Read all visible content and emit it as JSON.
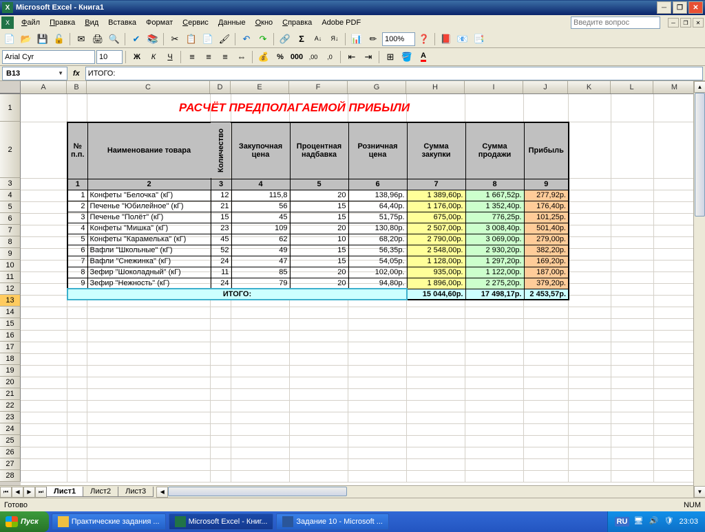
{
  "titlebar": {
    "title": "Microsoft Excel - Книга1"
  },
  "menus": [
    "Файл",
    "Правка",
    "Вид",
    "Вставка",
    "Формат",
    "Сервис",
    "Данные",
    "Окно",
    "Справка",
    "Adobe PDF"
  ],
  "ask_placeholder": "Введите вопрос",
  "font_name": "Arial Cyr",
  "font_size": "10",
  "zoom": "100%",
  "namebox": "B13",
  "formula": "ИТОГО:",
  "columns": [
    {
      "l": "A",
      "w": 67
    },
    {
      "l": "B",
      "w": 29
    },
    {
      "l": "C",
      "w": 179
    },
    {
      "l": "D",
      "w": 30
    },
    {
      "l": "E",
      "w": 85
    },
    {
      "l": "F",
      "w": 85
    },
    {
      "l": "G",
      "w": 85
    },
    {
      "l": "H",
      "w": 85
    },
    {
      "l": "I",
      "w": 85
    },
    {
      "l": "J",
      "w": 65
    },
    {
      "l": "K",
      "w": 62
    },
    {
      "l": "L",
      "w": 62
    },
    {
      "l": "M",
      "w": 62
    }
  ],
  "rows": [
    {
      "n": 1,
      "h": 40
    },
    {
      "n": 2,
      "h": 82
    },
    {
      "n": 3,
      "h": 17
    },
    {
      "n": 4,
      "h": 17
    },
    {
      "n": 5,
      "h": 17
    },
    {
      "n": 6,
      "h": 17
    },
    {
      "n": 7,
      "h": 17
    },
    {
      "n": 8,
      "h": 17
    },
    {
      "n": 9,
      "h": 17
    },
    {
      "n": 10,
      "h": 17
    },
    {
      "n": 11,
      "h": 17
    },
    {
      "n": 12,
      "h": 17
    },
    {
      "n": 13,
      "h": 17
    },
    {
      "n": 14,
      "h": 17
    },
    {
      "n": 15,
      "h": 17
    },
    {
      "n": 16,
      "h": 17
    },
    {
      "n": 17,
      "h": 17
    },
    {
      "n": 18,
      "h": 17
    },
    {
      "n": 19,
      "h": 17
    },
    {
      "n": 20,
      "h": 17
    },
    {
      "n": 21,
      "h": 17
    },
    {
      "n": 22,
      "h": 17
    },
    {
      "n": 23,
      "h": 17
    },
    {
      "n": 24,
      "h": 17
    },
    {
      "n": 25,
      "h": 17
    },
    {
      "n": 26,
      "h": 17
    },
    {
      "n": 27,
      "h": 17
    },
    {
      "n": 28,
      "h": 17
    }
  ],
  "sheet_title": "РАСЧЁТ ПРЕДПОЛАГАЕМОЙ ПРИБЫЛИ",
  "headers": {
    "c1": "№ п.п.",
    "c2": "Наименование товара",
    "c3": "Количество",
    "c4": "Закупочная цена",
    "c5": "Процентная надбавка",
    "c6": "Розничная цена",
    "c7": "Сумма закупки",
    "c8": "Сумма продажи",
    "c9": "Прибыль"
  },
  "numrow": [
    "1",
    "2",
    "3",
    "4",
    "5",
    "6",
    "7",
    "8",
    "9"
  ],
  "data": [
    {
      "n": "1",
      "name": "Конфеты \"Белочка\" (кГ)",
      "qty": "12",
      "buy": "115,8",
      "pct": "20",
      "retail": "138,96р.",
      "sumbuy": "1 389,60р.",
      "sumsell": "1 667,52р.",
      "profit": "277,92р."
    },
    {
      "n": "2",
      "name": "Печенье \"Юбилейное\" (кГ)",
      "qty": "21",
      "buy": "56",
      "pct": "15",
      "retail": "64,40р.",
      "sumbuy": "1 176,00р.",
      "sumsell": "1 352,40р.",
      "profit": "176,40р."
    },
    {
      "n": "3",
      "name": "Печенье \"Полёт\" (кГ)",
      "qty": "15",
      "buy": "45",
      "pct": "15",
      "retail": "51,75р.",
      "sumbuy": "675,00р.",
      "sumsell": "776,25р.",
      "profit": "101,25р."
    },
    {
      "n": "4",
      "name": "Конфеты \"Мишка\" (кГ)",
      "qty": "23",
      "buy": "109",
      "pct": "20",
      "retail": "130,80р.",
      "sumbuy": "2 507,00р.",
      "sumsell": "3 008,40р.",
      "profit": "501,40р."
    },
    {
      "n": "5",
      "name": "Конфеты \"Карамелька\" (кГ)",
      "qty": "45",
      "buy": "62",
      "pct": "10",
      "retail": "68,20р.",
      "sumbuy": "2 790,00р.",
      "sumsell": "3 069,00р.",
      "profit": "279,00р."
    },
    {
      "n": "6",
      "name": "Вафли \"Школьные\" (кГ)",
      "qty": "52",
      "buy": "49",
      "pct": "15",
      "retail": "56,35р.",
      "sumbuy": "2 548,00р.",
      "sumsell": "2 930,20р.",
      "profit": "382,20р."
    },
    {
      "n": "7",
      "name": "Вафли \"Снежинка\" (кГ)",
      "qty": "24",
      "buy": "47",
      "pct": "15",
      "retail": "54,05р.",
      "sumbuy": "1 128,00р.",
      "sumsell": "1 297,20р.",
      "profit": "169,20р."
    },
    {
      "n": "8",
      "name": "Зефир \"Шоколадный\" (кГ)",
      "qty": "11",
      "buy": "85",
      "pct": "20",
      "retail": "102,00р.",
      "sumbuy": "935,00р.",
      "sumsell": "1 122,00р.",
      "profit": "187,00р."
    },
    {
      "n": "9",
      "name": "Зефир \"Нежность\" (кГ)",
      "qty": "24",
      "buy": "79",
      "pct": "20",
      "retail": "94,80р.",
      "sumbuy": "1 896,00р.",
      "sumsell": "2 275,20р.",
      "profit": "379,20р."
    }
  ],
  "total": {
    "label": "ИТОГО:",
    "sumbuy": "15 044,60р.",
    "sumsell": "17 498,17р.",
    "profit": "2 453,57р."
  },
  "sheets": [
    "Лист1",
    "Лист2",
    "Лист3"
  ],
  "status": {
    "ready": "Готово",
    "num": "NUM"
  },
  "taskbar": {
    "start": "Пуск",
    "tasks": [
      {
        "label": "Практические задания ...",
        "t": "f"
      },
      {
        "label": "Microsoft Excel - Книг...",
        "t": "xl",
        "active": true
      },
      {
        "label": "Задание 10 - Microsoft ...",
        "t": "wd"
      }
    ],
    "lang": "RU",
    "time": "23:03"
  }
}
